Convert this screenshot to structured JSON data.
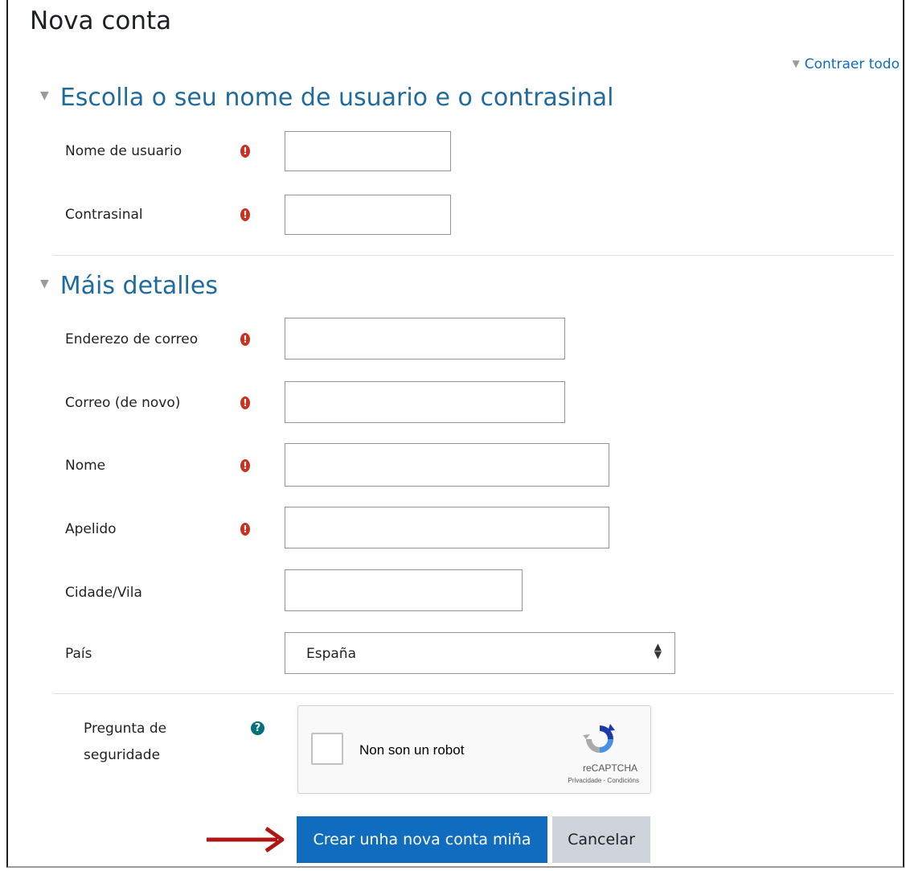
{
  "page_title": "Nova conta",
  "collapse_all": "Contraer todo",
  "sections": [
    {
      "title": "Escolla o seu nome de usuario e o contrasinal"
    },
    {
      "title": "Máis detalles"
    }
  ],
  "fields": {
    "username": {
      "label": "Nome de usuario",
      "value": ""
    },
    "password": {
      "label": "Contrasinal",
      "value": ""
    },
    "email": {
      "label": "Enderezo de correo",
      "value": ""
    },
    "email_again": {
      "label": "Correo (de novo)",
      "value": ""
    },
    "firstname": {
      "label": "Nome",
      "value": ""
    },
    "lastname": {
      "label": "Apelido",
      "value": ""
    },
    "city": {
      "label": "Cidade/Vila",
      "value": ""
    },
    "country": {
      "label": "País",
      "value": "España"
    }
  },
  "security": {
    "label_line1": "Pregunta de",
    "label_line2": "seguridade",
    "captcha_label": "Non son un robot",
    "captcha_brand": "reCAPTCHA",
    "captcha_terms": "Privacidade - Condicións"
  },
  "buttons": {
    "submit": "Crear unha nova conta miña",
    "cancel": "Cancelar"
  },
  "icons": {
    "required": "exclamation-circle-icon",
    "help": "question-circle-icon",
    "section_toggle": "triangle-down-icon"
  },
  "colors": {
    "primary": "#0f6cbf",
    "required": "#ca3120",
    "help": "#00707a",
    "section_title": "#1f6b9e",
    "annotation_arrow": "#b01515"
  }
}
